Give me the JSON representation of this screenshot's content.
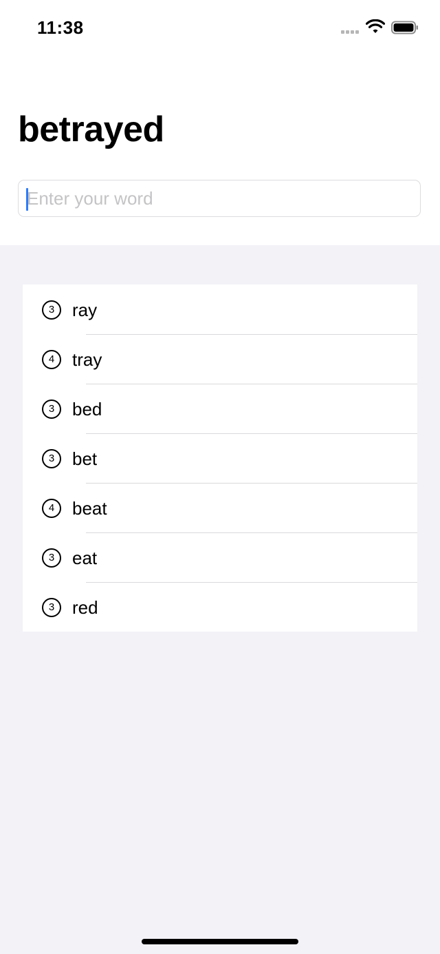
{
  "status_bar": {
    "time": "11:38",
    "icons": [
      "cellular-signal-icon",
      "wifi-icon",
      "battery-icon"
    ]
  },
  "header": {
    "title": "betrayed"
  },
  "word_input": {
    "placeholder": "Enter your word",
    "value": ""
  },
  "words": [
    {
      "score": "3",
      "word": "ray"
    },
    {
      "score": "4",
      "word": "tray"
    },
    {
      "score": "3",
      "word": "bed"
    },
    {
      "score": "3",
      "word": "bet"
    },
    {
      "score": "4",
      "word": "beat"
    },
    {
      "score": "3",
      "word": "eat"
    },
    {
      "score": "3",
      "word": "red"
    }
  ],
  "colors": {
    "background": "#f2f2f7",
    "surface": "#ffffff",
    "accent": "#2f7cf6",
    "placeholder": "#c4c4c6",
    "separator": "#d9d9dc"
  }
}
